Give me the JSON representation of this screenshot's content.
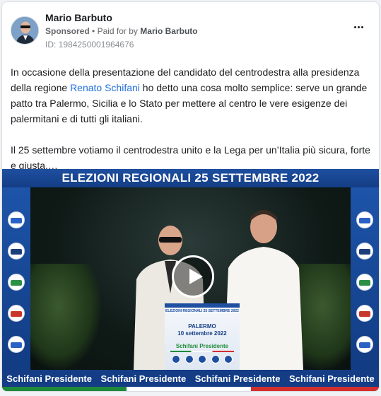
{
  "post": {
    "author": "Mario Barbuto",
    "sponsored_label": "Sponsored",
    "separator": "•",
    "paid_for_by": "Paid for by",
    "payer": "Mario Barbuto",
    "ad_id": "ID: 1984250001964676",
    "text_p1_a": "In occasione della presentazione del candidato del centrodestra alla presidenza della regione ",
    "text_p1_link": "Renato Schifani",
    "text_p1_b": " ho detto una cosa molto semplice: serve un grande patto tra Palermo, Sicilia e lo Stato per mettere al centro le vere esigenze dei palermitani e di tutti gli italiani.",
    "text_p2": "Il 25 settembre votiamo il centrodestra unito e la Lega per un’Italia più sicura, forte e giusta.…"
  },
  "media": {
    "banner_title": "ELEZIONI REGIONALI 25 SETTEMBRE 2022",
    "podium_title": "ELEZIONI REGIONALI 25 SETTEMBRE 2022",
    "podium_city": "PALERMO",
    "podium_date": "10 settembre 2022",
    "podium_slogan": "Schifani Presidente",
    "bottom_slogans": [
      "Schifani Presidente",
      "Schifani Presidente",
      "Schifani Presidente",
      "Schifani Presidente"
    ],
    "play_icon": "play-icon"
  },
  "colors": {
    "link": "#216fdb",
    "banner_blue": "#143d86",
    "slogan_green": "#1e8a3a"
  }
}
